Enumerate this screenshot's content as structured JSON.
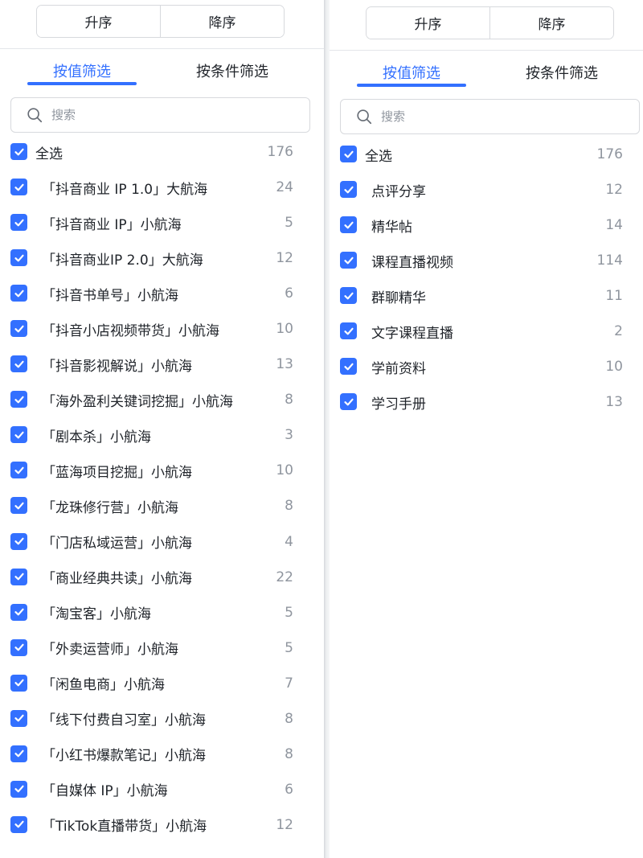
{
  "left": {
    "sort": {
      "asc": "升序",
      "desc": "降序"
    },
    "tabs": {
      "by_value": "按值筛选",
      "by_condition": "按条件筛选"
    },
    "search": {
      "placeholder": "搜索"
    },
    "select_all": {
      "label": "全选",
      "count": "176",
      "checked": true
    },
    "items": [
      {
        "label": "「抖音商业 IP 1.0」大航海",
        "count": "24",
        "checked": true
      },
      {
        "label": "「抖音商业 IP」小航海",
        "count": "5",
        "checked": true
      },
      {
        "label": "「抖音商业IP 2.0」大航海",
        "count": "12",
        "checked": true
      },
      {
        "label": "「抖音书单号」小航海",
        "count": "6",
        "checked": true
      },
      {
        "label": "「抖音小店视频带货」小航海",
        "count": "10",
        "checked": true
      },
      {
        "label": "「抖音影视解说」小航海",
        "count": "13",
        "checked": true
      },
      {
        "label": "「海外盈利关键词挖掘」小航海",
        "count": "8",
        "checked": true
      },
      {
        "label": "「剧本杀」小航海",
        "count": "3",
        "checked": true
      },
      {
        "label": "「蓝海项目挖掘」小航海",
        "count": "10",
        "checked": true
      },
      {
        "label": "「龙珠修行营」小航海",
        "count": "8",
        "checked": true
      },
      {
        "label": "「门店私域运营」小航海",
        "count": "4",
        "checked": true
      },
      {
        "label": "「商业经典共读」小航海",
        "count": "22",
        "checked": true
      },
      {
        "label": "「淘宝客」小航海",
        "count": "5",
        "checked": true
      },
      {
        "label": "「外卖运营师」小航海",
        "count": "5",
        "checked": true
      },
      {
        "label": "「闲鱼电商」小航海",
        "count": "7",
        "checked": true
      },
      {
        "label": "「线下付费自习室」小航海",
        "count": "8",
        "checked": true
      },
      {
        "label": "「小红书爆款笔记」小航海",
        "count": "8",
        "checked": true
      },
      {
        "label": "「自媒体 IP」小航海",
        "count": "6",
        "checked": true
      },
      {
        "label": "「TikTok直播带货」小航海",
        "count": "12",
        "checked": true
      }
    ]
  },
  "right": {
    "sort": {
      "asc": "升序",
      "desc": "降序"
    },
    "tabs": {
      "by_value": "按值筛选",
      "by_condition": "按条件筛选"
    },
    "search": {
      "placeholder": "搜索"
    },
    "select_all": {
      "label": "全选",
      "count": "176",
      "checked": true
    },
    "items": [
      {
        "label": "点评分享",
        "count": "12",
        "checked": true
      },
      {
        "label": "精华帖",
        "count": "14",
        "checked": true
      },
      {
        "label": "课程直播视频",
        "count": "114",
        "checked": true
      },
      {
        "label": "群聊精华",
        "count": "11",
        "checked": true
      },
      {
        "label": "文字课程直播",
        "count": "2",
        "checked": true
      },
      {
        "label": "学前资料",
        "count": "10",
        "checked": true
      },
      {
        "label": "学习手册",
        "count": "13",
        "checked": true
      }
    ]
  },
  "colors": {
    "accent": "#3370ff",
    "count_text": "#8f959e",
    "border": "#d7d9dd"
  },
  "icons": {
    "search": "search-icon",
    "checkbox": "checkmark-icon"
  }
}
